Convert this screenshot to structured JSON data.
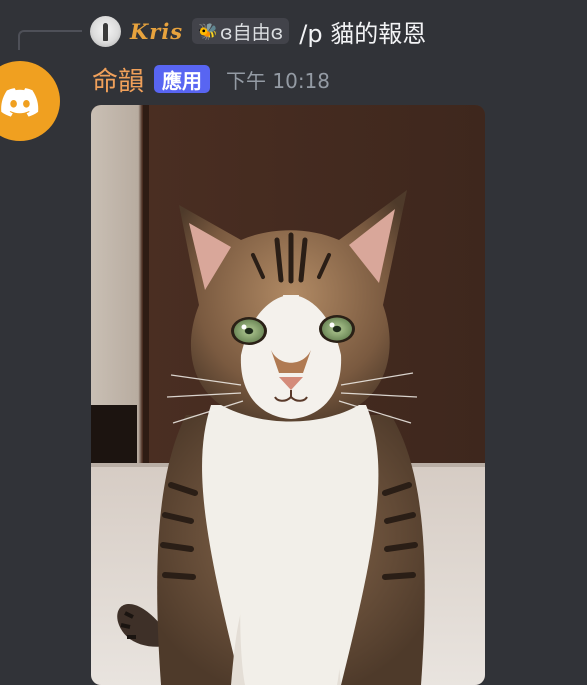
{
  "reply": {
    "username": "Kris",
    "tag_icon": "bee-icon",
    "tag_text": "ɞ自由ɞ",
    "content": "/p 貓的報恩"
  },
  "message": {
    "author": "命韻",
    "badge": "應用",
    "timestamp": "下午 10:18",
    "avatar_icon": "discord-logo-icon"
  },
  "attachment": {
    "subject": "tabby-and-white cat photo"
  },
  "colors": {
    "background": "#313338",
    "author_name": "#f0a05a",
    "reply_username": "#e8a33d",
    "app_badge": "#5865f2",
    "avatar_bg": "#f0a020",
    "timestamp": "#949ba4"
  }
}
